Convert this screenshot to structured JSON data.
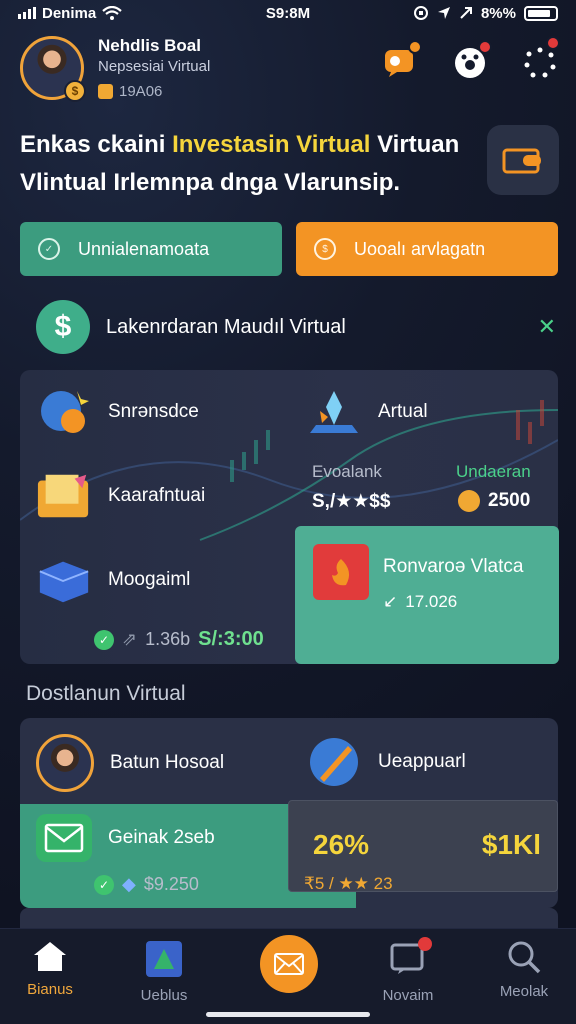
{
  "status": {
    "carrier": "Denima",
    "time": "S9:8M",
    "battery": "8%%"
  },
  "profile": {
    "name": "Nehdlis Boal",
    "subtitle": "Nepsesiai Virtual",
    "points": "19A06"
  },
  "headline": {
    "prefix": "Enkas ckaini ",
    "highlight": "Investasin Virtual",
    "rest": " Virtuan Vlintual Irlemnpa dnga Vlarunsip."
  },
  "buttons": {
    "primary": "Unnialenamoata",
    "secondary": "Uooalı arvlagatn"
  },
  "section1": {
    "title": "Lakenrdaran Maudıl Virtual"
  },
  "grid": {
    "item1": "Snrənsdce",
    "item2": "Artual",
    "item3": "Kaarafntuai",
    "item4": "Moogaiml",
    "stat_left_label": "Evoalank",
    "stat_left_value": "S,/★★$$",
    "stat_right_label": "Undaeran",
    "stat_right_value": "2500",
    "footer_left": "1.36b",
    "footer_right": "S/:3:00",
    "highlight_title": "Ronvaroə Vlatca",
    "highlight_value": "17.026"
  },
  "section2": {
    "title": "Dostlanun Virtual",
    "person": "Batun Hosoal",
    "tool": "Ueappuarl",
    "mail": "Geinak 2seb",
    "footer_value": "$9.250",
    "stat_pct": "26%",
    "stat_val": "$1Kl",
    "stars": "₹5 / ★★ 23"
  },
  "tabs": [
    {
      "label": "Bianus",
      "active": true
    },
    {
      "label": "Ueblus",
      "active": false
    },
    {
      "label": "",
      "active": false
    },
    {
      "label": "Novaim",
      "active": false
    },
    {
      "label": "Meolak",
      "active": false
    }
  ],
  "colors": {
    "accent_orange": "#f39424",
    "accent_green": "#3c9c7f",
    "highlight_yellow": "#f5d53c",
    "teal_card": "#4fae94"
  }
}
